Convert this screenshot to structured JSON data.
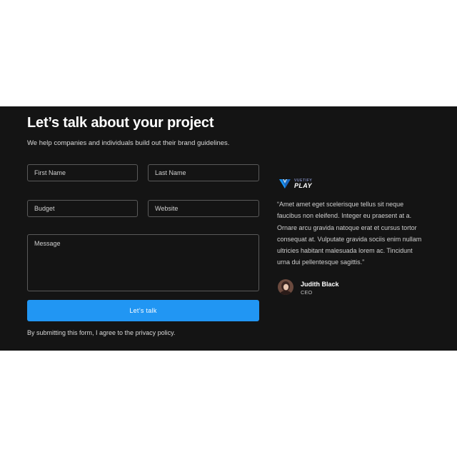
{
  "contact": {
    "title": "Let’s talk about your project",
    "subtitle": "We help companies and individuals build out their brand guidelines.",
    "fields": {
      "first_name": "First Name",
      "last_name": "Last Name",
      "budget": "Budget",
      "website": "Website",
      "message": "Message"
    },
    "submit_label": "Let’s talk",
    "disclaimer": "By submitting this form, I agree to the privacy policy."
  },
  "testimonial": {
    "logo_small": "VUETIFY",
    "logo_big": "PLAY",
    "quote": "“Amet amet eget scelerisque tellus sit neque faucibus non eleifend. Integer eu praesent at a. Ornare arcu gravida natoque erat et cursus tortor consequat at. Vulputate gravida sociis enim nullam ultricies habitant malesuada lorem ac. Tincidunt urna dui pellentesque sagittis.”",
    "author_name": "Judith Black",
    "author_role": "CEO"
  },
  "colors": {
    "background": "#141414",
    "accent": "#2196f3"
  }
}
